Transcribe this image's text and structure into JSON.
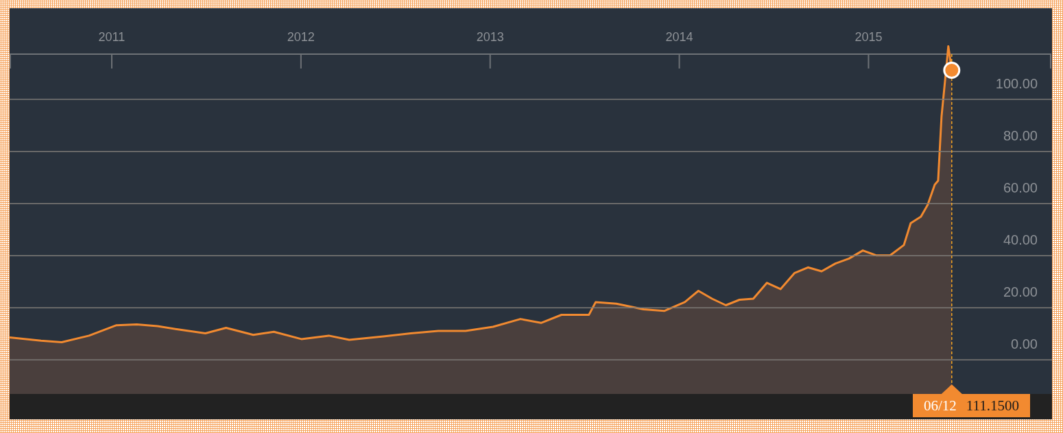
{
  "chart": {
    "chart_data": {
      "type": "area",
      "grid": true,
      "xlim": [
        2010.46,
        2015.97
      ],
      "ylim": [
        -22.8,
        135
      ],
      "xticks": [
        {
          "value": 2011,
          "label": "2011"
        },
        {
          "value": 2012,
          "label": "2012"
        },
        {
          "value": 2013,
          "label": "2013"
        },
        {
          "value": 2014,
          "label": "2014"
        },
        {
          "value": 2015,
          "label": "2015"
        }
      ],
      "yticks": [
        {
          "value": 0,
          "label": "0.00"
        },
        {
          "value": 20,
          "label": "20.00"
        },
        {
          "value": 40,
          "label": "40.00"
        },
        {
          "value": 60,
          "label": "60.00"
        },
        {
          "value": 80,
          "label": "80.00"
        },
        {
          "value": 100,
          "label": "100.00"
        }
      ],
      "x": [
        2010.46,
        2010.626,
        2010.735,
        2010.88,
        2011.025,
        2011.132,
        2011.242,
        2011.35,
        2011.495,
        2011.604,
        2011.748,
        2011.857,
        2012.002,
        2012.147,
        2012.255,
        2012.436,
        2012.581,
        2012.726,
        2012.87,
        2013.015,
        2013.16,
        2013.269,
        2013.377,
        2013.522,
        2013.558,
        2013.667,
        2013.811,
        2013.92,
        2014.029,
        2014.101,
        2014.173,
        2014.246,
        2014.318,
        2014.391,
        2014.463,
        2014.535,
        2014.608,
        2014.68,
        2014.752,
        2014.825,
        2014.897,
        2014.97,
        2015.042,
        2015.114,
        2015.187,
        2015.223,
        2015.277,
        2015.313,
        2015.35,
        2015.368,
        2015.386,
        2015.411,
        2015.422,
        2015.44
      ],
      "series": [
        {
          "color": "#f28a30",
          "values": [
            8.6,
            7.4,
            6.8,
            9.3,
            13.3,
            13.6,
            13,
            11.7,
            10.2,
            12.3,
            9.6,
            10.8,
            8,
            9.3,
            7.7,
            9,
            10.2,
            11.1,
            11.1,
            12.7,
            15.7,
            14.2,
            17.3,
            17.3,
            22.2,
            21.6,
            19.4,
            18.8,
            22.2,
            26.5,
            23.5,
            21,
            23.1,
            23.5,
            29.6,
            27.2,
            33.3,
            35.5,
            34,
            37,
            38.9,
            42,
            40.1,
            40.1,
            44.1,
            52.5,
            55,
            59.6,
            67.3,
            68.8,
            93.5,
            112,
            120.4,
            111.2
          ]
        }
      ],
      "ref_lines": [
        {
          "axis": "x",
          "value": 2015.44,
          "color": "#f5a623"
        }
      ]
    },
    "cursor": {
      "date": "06/12",
      "value": "111.1500"
    }
  }
}
